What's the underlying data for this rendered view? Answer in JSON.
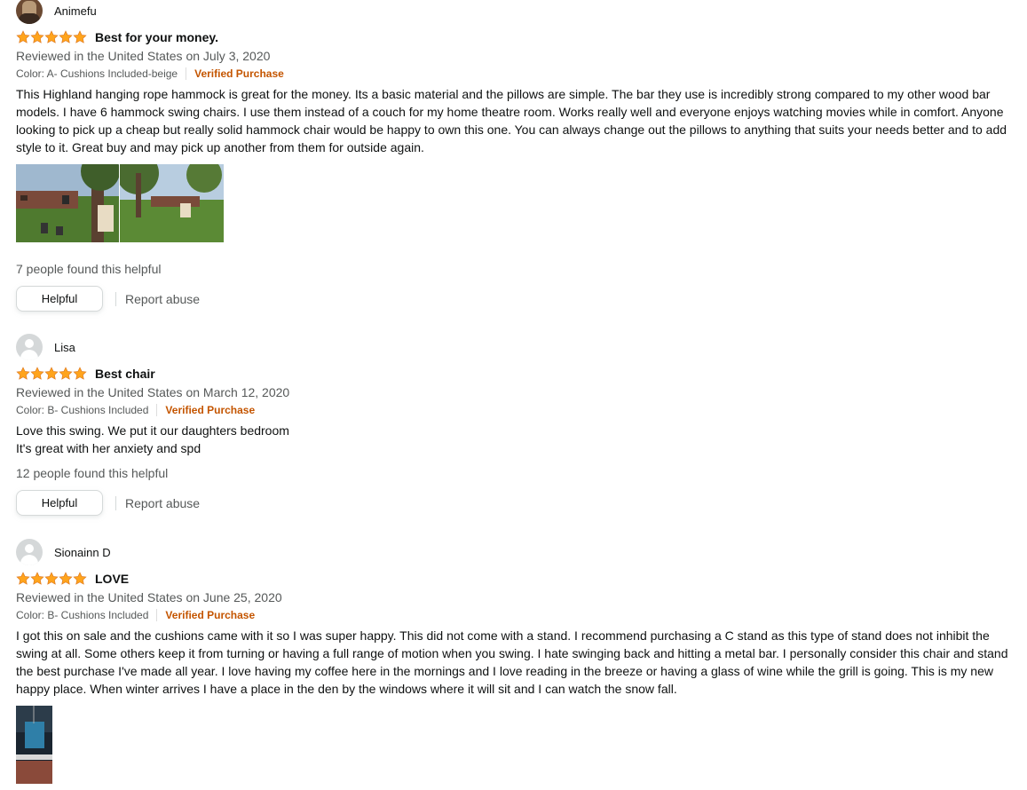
{
  "reviews": [
    {
      "profile_name": "Animefu",
      "rating": "5.0 out of 5 stars",
      "title": "Best for your money.",
      "date": "Reviewed in the United States on July 3, 2020",
      "variant": "Color: A- Cushions Included-beige",
      "verified": "Verified Purchase",
      "body": [
        "This Highland hanging rope hammock is great for the money. Its a basic material and the pillows are simple. The bar they use is incredibly strong compared to my other wood bar models. I have 6 hammock swing chairs. I use them instead of a couch for my home theatre room. Works really well and everyone enjoys watching movies while in comfort. Anyone looking to pick up a cheap but really solid hammock chair would be happy to own this one. You can always change out the pillows to anything that suits your needs better and to add style to it. Great buy and may pick up another from them for outside again."
      ],
      "helpful_text": "7 people found this helpful",
      "helpful_button": "Helpful",
      "report": "Report abuse"
    },
    {
      "profile_name": "Lisa",
      "rating": "5.0 out of 5 stars",
      "title": "Best chair",
      "date": "Reviewed in the United States on March 12, 2020",
      "variant": "Color: B- Cushions Included",
      "verified": "Verified Purchase",
      "body": [
        "Love this swing. We put it our daughters bedroom",
        "It's great with her anxiety and spd"
      ],
      "helpful_text": "12 people found this helpful",
      "helpful_button": "Helpful",
      "report": "Report abuse"
    },
    {
      "profile_name": "Sionainn D",
      "rating": "5.0 out of 5 stars",
      "title": "LOVE",
      "date": "Reviewed in the United States on June 25, 2020",
      "variant": "Color: B- Cushions Included",
      "verified": "Verified Purchase",
      "body": [
        "I got this on sale and the cushions came with it so I was super happy. This did not come with a stand. I recommend purchasing a C stand as this type of stand does not inhibit the swing at all. Some others keep it from turning or having a full range of motion when you swing. I hate swinging back and hitting a metal bar. I personally consider this chair and stand the best purchase I've made all year. I love having my coffee here in the mornings and I love reading in the breeze or having a glass of wine while the grill is going. This is my new happy place. When winter arrives I have a place in the den by the windows where it will sit and I can watch the snow fall."
      ]
    }
  ],
  "colors": {
    "star": "#ffa41c",
    "verified": "#c45500",
    "muted": "#565959"
  }
}
